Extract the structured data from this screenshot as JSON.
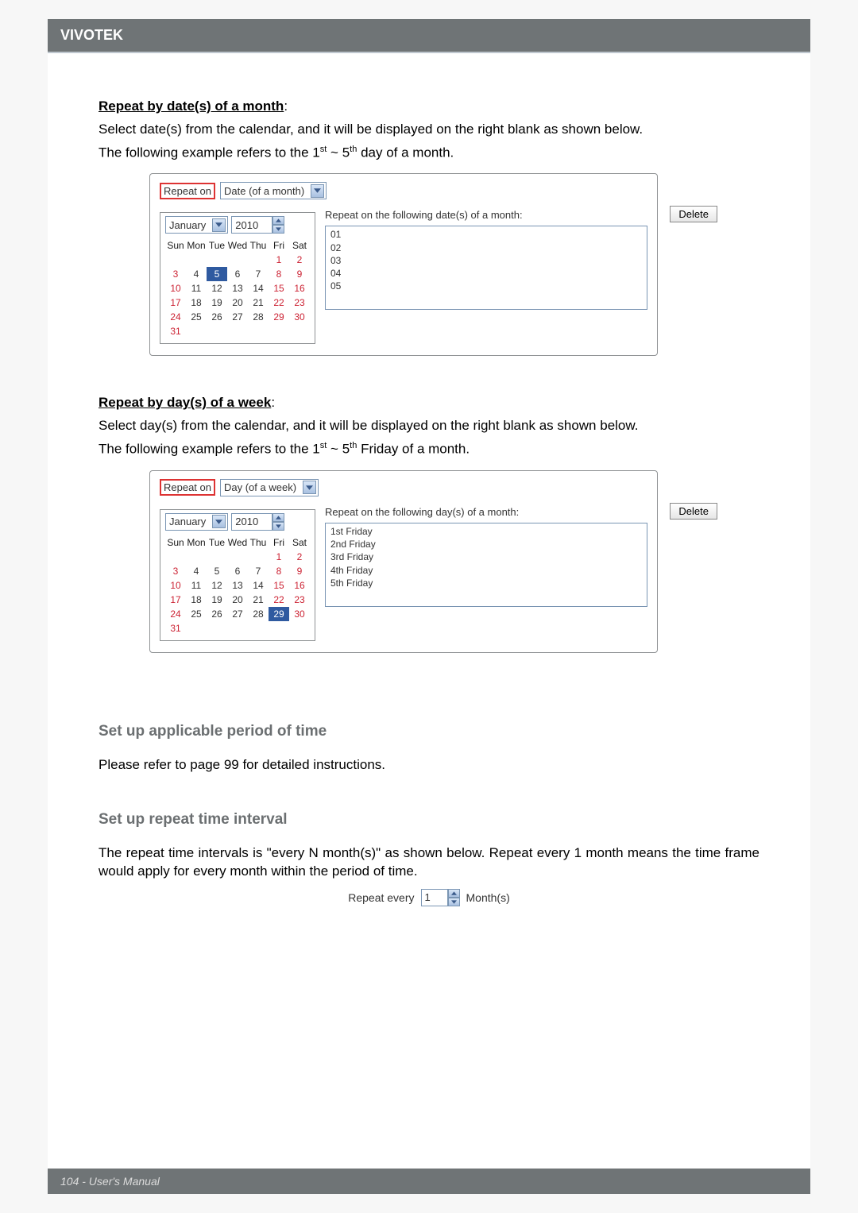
{
  "header": {
    "brand": "VIVOTEK"
  },
  "sectionA": {
    "title": "Repeat by date(s) of a month",
    "p1": "Select date(s) from the calendar, and it will be displayed on the right blank as shown below.",
    "p2a": "The following example refers to the 1",
    "p2b": " ~ 5",
    "p2c": " day of a month.",
    "sup1": "st",
    "sup2": "th"
  },
  "uiA": {
    "repeatLabel": "Repeat on",
    "modeLabel": "Date (of a month)",
    "monthLabel": "January",
    "year": "2010",
    "rightLabel": "Repeat on the following date(s) of a month:",
    "listItems": [
      "01",
      "02",
      "03",
      "04",
      "05"
    ],
    "deleteLabel": "Delete",
    "dayHeaders": [
      "Sun",
      "Mon",
      "Tue",
      "Wed",
      "Thu",
      "Fri",
      "Sat"
    ],
    "rows": [
      [
        "",
        "",
        "",
        "",
        "",
        "1",
        "2"
      ],
      [
        "3",
        "4",
        "5",
        "6",
        "7",
        "8",
        "9"
      ],
      [
        "10",
        "11",
        "12",
        "13",
        "14",
        "15",
        "16"
      ],
      [
        "17",
        "18",
        "19",
        "20",
        "21",
        "22",
        "23"
      ],
      [
        "24",
        "25",
        "26",
        "27",
        "28",
        "29",
        "30"
      ],
      [
        "31",
        "",
        "",
        "",
        "",
        "",
        ""
      ]
    ],
    "today": "5"
  },
  "sectionB": {
    "title": "Repeat by day(s) of a week",
    "p1": "Select day(s) from the calendar, and it will be displayed on the right blank as shown below.",
    "p2a": "The following example refers to the 1",
    "p2b": " ~ 5",
    "p2c": " Friday of a month.",
    "sup1": "st",
    "sup2": "th"
  },
  "uiB": {
    "repeatLabel": "Repeat on",
    "modeLabel": "Day (of a week)",
    "monthLabel": "January",
    "year": "2010",
    "rightLabel": "Repeat on the following day(s) of a month:",
    "listItems": [
      "1st Friday",
      "2nd Friday",
      "3rd Friday",
      "4th Friday",
      "5th Friday"
    ],
    "deleteLabel": "Delete",
    "dayHeaders": [
      "Sun",
      "Mon",
      "Tue",
      "Wed",
      "Thu",
      "Fri",
      "Sat"
    ],
    "rows": [
      [
        "",
        "",
        "",
        "",
        "",
        "1",
        "2"
      ],
      [
        "3",
        "4",
        "5",
        "6",
        "7",
        "8",
        "9"
      ],
      [
        "10",
        "11",
        "12",
        "13",
        "14",
        "15",
        "16"
      ],
      [
        "17",
        "18",
        "19",
        "20",
        "21",
        "22",
        "23"
      ],
      [
        "24",
        "25",
        "26",
        "27",
        "28",
        "29",
        "30"
      ],
      [
        "31",
        "",
        "",
        "",
        "",
        "",
        ""
      ]
    ],
    "today": "29"
  },
  "sectionC": {
    "heading": "Set up applicable period of time",
    "text": "Please refer to page 99 for detailed instructions."
  },
  "sectionD": {
    "heading": "Set up repeat time interval",
    "text": "The repeat time intervals is \"every N month(s)\" as shown below. Repeat every 1 month means the time frame would apply for every month within the period of time."
  },
  "repeatEvery": {
    "label": "Repeat every",
    "value": "1",
    "unit": "Month(s)"
  },
  "footer": {
    "text": "104 - User's Manual"
  }
}
